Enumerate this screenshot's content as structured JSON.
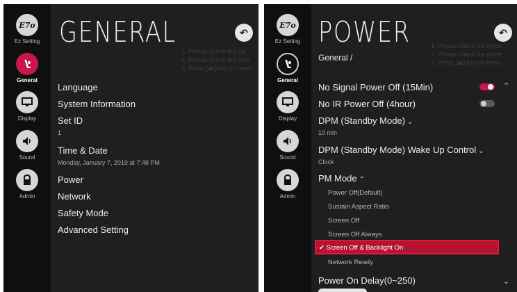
{
  "sidebar": {
    "items": [
      {
        "label": "Ez Setting",
        "glyph": "E7o"
      },
      {
        "label": "General",
        "glyph": "⚖"
      },
      {
        "label": "Display",
        "glyph": "▣"
      },
      {
        "label": "Sound",
        "glyph": "◀"
      },
      {
        "label": "Admin",
        "glyph": "🔒"
      }
    ]
  },
  "left": {
    "title": "GENERAL",
    "back_icon": "↶",
    "hint_lines": [
      "1. Please check the inp",
      "2. Please check the pow",
      "3. Press [⏏] key on remo"
    ],
    "menu": [
      {
        "label": "Language",
        "value": ""
      },
      {
        "label": "System Information",
        "value": ""
      },
      {
        "label": "Set ID",
        "value": "1"
      },
      {
        "label": "Time & Date",
        "value": "Monday, January 7, 2019 at 7:48 PM"
      },
      {
        "label": "Power",
        "value": ""
      },
      {
        "label": "Network",
        "value": ""
      },
      {
        "label": "Safety Mode",
        "value": ""
      },
      {
        "label": "Advanced Setting",
        "value": ""
      }
    ]
  },
  "right": {
    "title": "POWER",
    "breadcrumb": "General /",
    "back_icon": "↶",
    "hint_lines": [
      "1. Please check the input.",
      "2. Please check the powe",
      "3. Press [⏏] key on remo"
    ],
    "no_signal": {
      "label": "No Signal Power Off (15Min)",
      "on": true
    },
    "no_ir": {
      "label": "No IR Power Off (4hour)",
      "on": false
    },
    "dpm": {
      "label": "DPM (Standby Mode)",
      "value": "10 min"
    },
    "dpm_wake": {
      "label": "DPM (Standby Mode) Wake Up Control",
      "value": "Clock"
    },
    "pm_mode": {
      "label": "PM Mode",
      "options": [
        "Power Off(Default)",
        "Sustain Aspect Ratio",
        "Screen Off",
        "Screen Off Always",
        "Screen Off & Backlight On",
        "Network Ready"
      ],
      "selected": "Screen Off & Backlight On"
    },
    "power_on_delay": {
      "label": "Power On Delay(0~250)"
    }
  },
  "colors": {
    "accent": "#c8174a",
    "highlight": "#e0173f",
    "panel": "#1f1f1f",
    "sidebar": "#0f0f0f"
  }
}
